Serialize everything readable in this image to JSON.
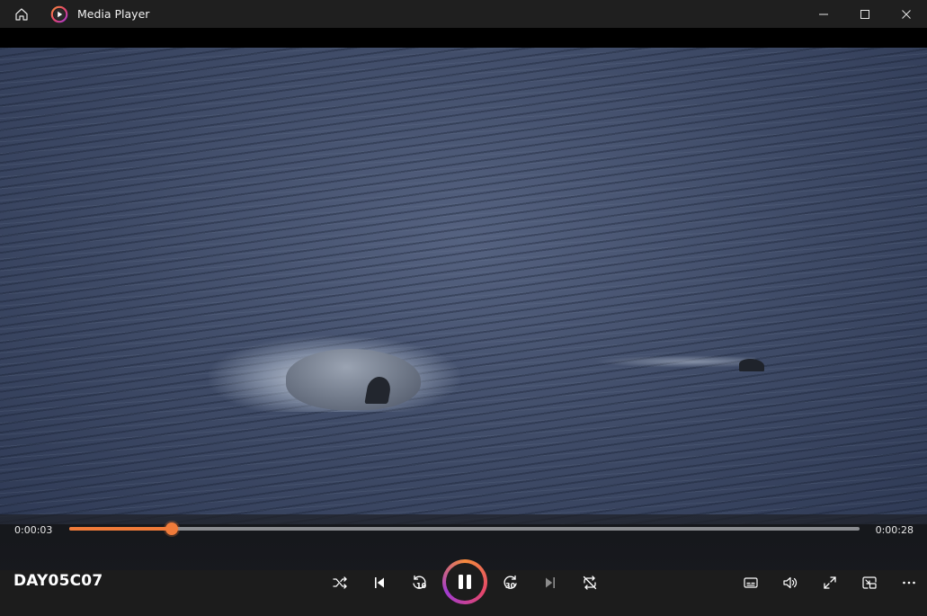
{
  "window": {
    "title": "Media Player",
    "icons": {
      "home": "home-icon",
      "logo": "media-player-logo-icon",
      "minimize": "minimize-icon",
      "maximize": "maximize-icon",
      "close": "close-icon"
    }
  },
  "player": {
    "media_title": "DAY05C07",
    "time_elapsed": "0:00:03",
    "time_total": "0:00:28",
    "progress_fraction": 0.13,
    "skip_back_label": "10",
    "skip_forward_label": "30",
    "colors": {
      "accent": "#f07b3a",
      "track": "#8a8c90",
      "ring_start": "#f48a3c",
      "ring_mid": "#e5466b",
      "ring_end": "#a13bd0"
    },
    "controls": [
      "shuffle-icon",
      "previous-icon",
      "rewind-10-icon",
      "pause-icon",
      "forward-30-icon",
      "next-icon",
      "repeat-icon",
      "captions-icon",
      "volume-icon",
      "fullscreen-icon",
      "miniplayer-icon",
      "more-icon"
    ]
  }
}
